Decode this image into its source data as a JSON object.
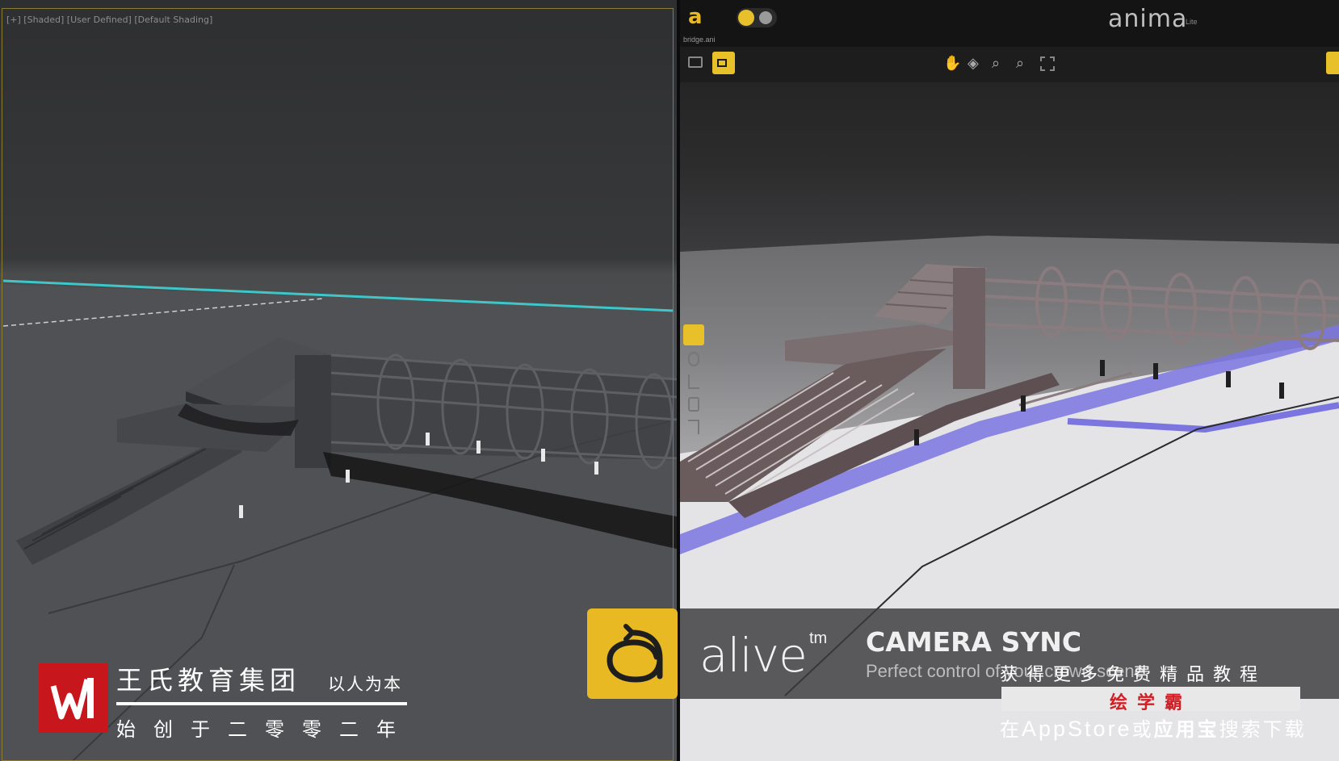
{
  "left_viewport": {
    "label": "[+] [Shaded] [User Defined] [Default Shading]"
  },
  "anima": {
    "logo_glyph": "a",
    "brand": "anima",
    "brand_suffix": "Lite",
    "file_name": "bridge.ani",
    "toolbar_icons": [
      "monitor-icon",
      "camera-icon",
      "hand-icon",
      "orbit-icon",
      "zoom-icon",
      "zoom-region-icon",
      "frame-all-icon"
    ],
    "side_tools": [
      "select-tool-icon",
      "path-tool-icon",
      "walk-tool-icon",
      "actor-tool-icon",
      "crowd-tool-icon"
    ]
  },
  "banner": {
    "alive_word": "alive",
    "alive_tm": "tm",
    "title": "CAMERA SYNC",
    "subtitle": "Perfect control of your crowd scene"
  },
  "watermark_left": {
    "org_name": "王氏教育集团",
    "motto": "以人为本",
    "founded": "始创于二零零二年"
  },
  "watermark_right": {
    "line1": "获得更多免费精品教程",
    "app_name": "绘学霸",
    "line3_prefix": "在",
    "line3_store": "AppStore",
    "line3_or": "或",
    "line3_app2": "应用宝",
    "line3_suffix": "搜索下载"
  },
  "colors": {
    "accent_yellow": "#e8c12a",
    "brand_red": "#c8161d",
    "walkway_blue": "#7b75e0",
    "horizon_cyan": "#3fc6c8"
  }
}
